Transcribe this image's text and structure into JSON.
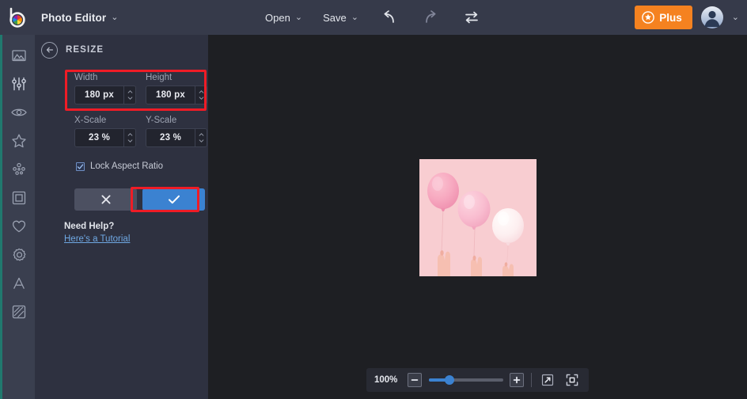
{
  "app": {
    "logo_icon": "bepicky-color-wheel-logo",
    "title": "Photo Editor",
    "title_caret": "⌄"
  },
  "topbar": {
    "menus": [
      {
        "label": "Open",
        "caret": "⌄",
        "name": "open-menu"
      },
      {
        "label": "Save",
        "caret": "⌄",
        "name": "save-menu"
      }
    ],
    "undo_icon": "undo-icon",
    "redo_icon": "redo-icon",
    "swap_icon": "compare-toggle-icon",
    "plus_label": "Plus",
    "plus_icon": "star-badge-icon",
    "plus_color": "#f58220",
    "avatar_icon": "user-avatar",
    "avatar_caret": "⌄"
  },
  "rail": {
    "accent_color": "#20796e",
    "items": [
      {
        "name": "sidebar-item-image",
        "icon": "landscape-photo-icon"
      },
      {
        "name": "sidebar-item-adjust",
        "icon": "sliders-icon"
      },
      {
        "name": "sidebar-item-effects",
        "icon": "eye-icon"
      },
      {
        "name": "sidebar-item-beautify",
        "icon": "star-outline-icon"
      },
      {
        "name": "sidebar-item-retouch",
        "icon": "particles-icon"
      },
      {
        "name": "sidebar-item-frames",
        "icon": "square-frame-icon"
      },
      {
        "name": "sidebar-item-stickers",
        "icon": "heart-icon"
      },
      {
        "name": "sidebar-item-overlays",
        "icon": "gear-flower-icon"
      },
      {
        "name": "sidebar-item-text",
        "icon": "letter-a-icon"
      },
      {
        "name": "sidebar-item-textures",
        "icon": "hatched-square-icon"
      }
    ]
  },
  "panel": {
    "back_icon": "back-arrow-icon",
    "title": "RESIZE",
    "highlight_color": "#ef1c26",
    "fields": [
      {
        "label": "Width",
        "value": "180 px",
        "name": "width-input"
      },
      {
        "label": "Height",
        "value": "180 px",
        "name": "height-input"
      },
      {
        "label": "X-Scale",
        "value": "23 %",
        "name": "x-scale-input"
      },
      {
        "label": "Y-Scale",
        "value": "23 %",
        "name": "y-scale-input"
      }
    ],
    "lock": {
      "label": "Lock Aspect Ratio",
      "checked": true
    },
    "cancel_icon": "close-x-icon",
    "apply_icon": "checkmark-icon",
    "apply_color": "#3b82d1",
    "help_title": "Need Help?",
    "help_link": "Here's a Tutorial"
  },
  "canvas": {
    "image_alt": "three pink balloons held by hands on pink background"
  },
  "zoombar": {
    "zoom_level": "100%",
    "minus_icon": "minus-icon",
    "plus_icon": "plus-icon",
    "slider_value": 22,
    "expand_icon": "open-in-new-icon",
    "fit_icon": "fit-to-screen-icon"
  }
}
